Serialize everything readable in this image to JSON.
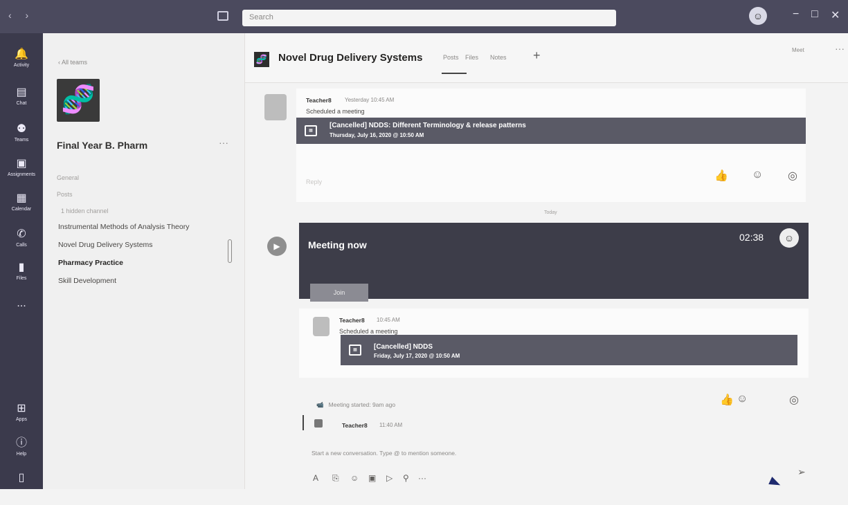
{
  "titlebar": {
    "nav_glyph": "‹ ›",
    "search_placeholder": "Search",
    "minimize": "−",
    "maximize": "□",
    "close": "✕"
  },
  "rail": [
    {
      "icon": "bell",
      "label": "Activity"
    },
    {
      "icon": "chat",
      "label": "Chat"
    },
    {
      "icon": "teams",
      "label": "Teams"
    },
    {
      "icon": "assignments",
      "label": "Assignments"
    },
    {
      "icon": "calendar",
      "label": "Calendar"
    },
    {
      "icon": "phone",
      "label": "Calls"
    },
    {
      "icon": "files",
      "label": "Files"
    },
    {
      "icon": "more",
      "label": "..."
    },
    {
      "icon": "apps",
      "label": "Apps"
    },
    {
      "icon": "help",
      "label": "Help"
    }
  ],
  "team_panel": {
    "back_label": "‹ All teams",
    "team_name": "Final Year B. Pharm",
    "more": "···",
    "section_1": "General",
    "section_2": "Posts",
    "hidden_label": "1 hidden channel",
    "channels": [
      {
        "name": "Instrumental Methods of Analysis Theory",
        "bold": false
      },
      {
        "name": "Novel Drug Delivery Systems",
        "bold": false
      },
      {
        "name": "Pharmacy Practice",
        "bold": true
      },
      {
        "name": "Skill Development",
        "bold": false
      }
    ]
  },
  "channel": {
    "title": "Novel Drug Delivery Systems",
    "tabs": [
      "Posts",
      "Files",
      "Notes"
    ],
    "add_tab": "+",
    "meet_label": "Meet",
    "more": "···"
  },
  "post1": {
    "sender": "Teacher8",
    "time": "Yesterday 10:45 AM",
    "action": "Scheduled a meeting",
    "card_title": "[Cancelled] NDDS: Different Terminology & release patterns",
    "card_date": "Thursday, July 16, 2020 @ 10:50 AM",
    "reply": "Reply"
  },
  "divider": "Today",
  "meeting_now": {
    "title": "Meeting now",
    "timer": "02:38",
    "join": "Join"
  },
  "post2": {
    "sender": "Teacher8",
    "time": "10:45 AM",
    "action": "Scheduled a meeting",
    "card_title": "[Cancelled] NDDS",
    "card_date": "Friday, July 17, 2020 @ 10:50 AM"
  },
  "ended": "Meeting started: 9am ago",
  "post3": {
    "sender": "Teacher8",
    "time": "11:40 AM"
  },
  "composer": {
    "placeholder": "Start a new conversation. Type @ to mention someone.",
    "send": "➢"
  }
}
